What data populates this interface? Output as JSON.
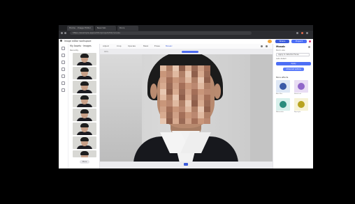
{
  "browser": {
    "tabs": [
      {
        "label": "Home · Image Editor"
      },
      {
        "label": "New tab"
      },
      {
        "label": "Docs"
      }
    ],
    "url": "https://example.app/editor/project/42/canvas"
  },
  "app": {
    "title": "Image editor workspace",
    "header_buttons": [
      {
        "label": "Share",
        "color": "#3b5bdb"
      },
      {
        "label": "Export",
        "color": "#4c6ef5"
      }
    ]
  },
  "sidebar": {
    "title": "My Assets · Images",
    "subtitle": "Recently",
    "footer_button": "More"
  },
  "toolbar": {
    "tools": [
      "Adjust",
      "Crop",
      "Upscale",
      "Mask",
      "Erase",
      "Mosaic"
    ]
  },
  "canvas": {
    "zoom_label": "66%",
    "accent": "#4c6ef5"
  },
  "right_panel": {
    "title": "Mosaic",
    "subtitle": "Block size",
    "select_value": "Apply to detected faces",
    "option": "Auto detect",
    "apply_button": "Apply",
    "more_button": "Advanced options",
    "section_title": "More effects",
    "cards": [
      {
        "caption": "Blur filter",
        "colors": [
          "#dfe8f5",
          "#3a5aa8"
        ]
      },
      {
        "caption": "Sketch art",
        "colors": [
          "#e9ddf4",
          "#9066c9"
        ]
      },
      {
        "caption": "Watercolor",
        "colors": [
          "#d9f0ec",
          "#2a8c7d"
        ]
      },
      {
        "caption": "Pop style",
        "colors": [
          "#f6f2d6",
          "#b8a31f"
        ]
      }
    ]
  }
}
